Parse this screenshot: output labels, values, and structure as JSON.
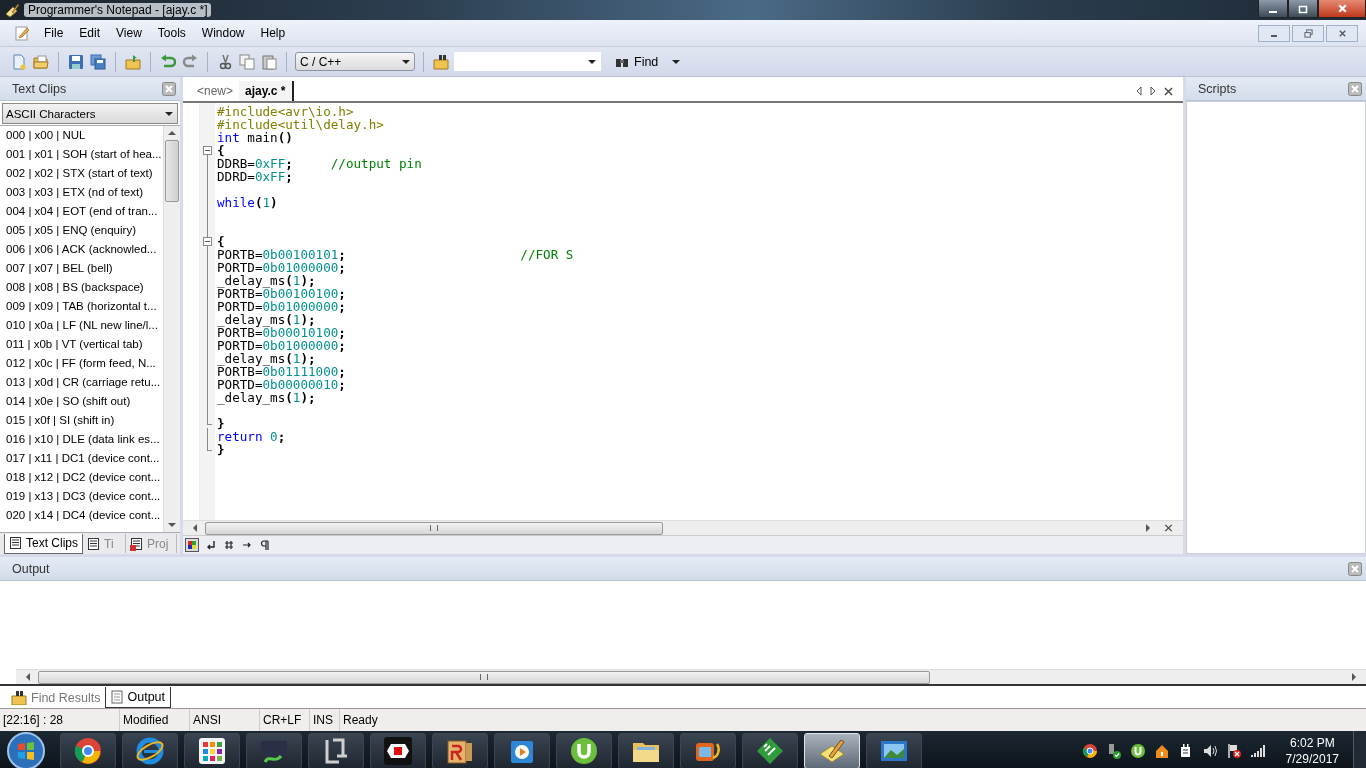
{
  "window": {
    "title": "Programmer's Notepad - [ajay.c *]"
  },
  "menu": [
    "File",
    "Edit",
    "View",
    "Tools",
    "Window",
    "Help"
  ],
  "toolbar": {
    "scheme": "C / C++",
    "find_label": "Find"
  },
  "text_clips": {
    "title": "Text Clips",
    "category": "ASCII Characters",
    "items": [
      "000 | x00 | NUL",
      "001 | x01 | SOH (start of hea...",
      "002 | x02 | STX (start of text)",
      "003 | x03 | ETX (nd of text)",
      "004 | x04 | EOT (end of tran...",
      "005 | x05 | ENQ (enquiry)",
      "006 | x06 | ACK (acknowled...",
      "007 | x07 | BEL (bell)",
      "008 | x08 | BS (backspace)",
      "009 | x09 | TAB (horizontal t...",
      "010 | x0a | LF (NL new line/l...",
      "011 | x0b | VT (vertical tab)",
      "012 | x0c | FF (form feed, N...",
      "013 | x0d | CR (carriage retu...",
      "014 | x0e | SO (shift out)",
      "015 | x0f | SI (shift in)",
      "016 | x10 | DLE (data link es...",
      "017 | x11 | DC1 (device cont...",
      "018 | x12 | DC2 (device cont...",
      "019 | x13 | DC3 (device cont...",
      "020 | x14 | DC4 (device cont..."
    ],
    "tabs": [
      {
        "label": "Text Clips",
        "selected": true
      },
      {
        "label": "Ti",
        "selected": false
      },
      {
        "label": "Proj",
        "selected": false
      }
    ]
  },
  "editor": {
    "tabs": [
      {
        "label": "<new>",
        "selected": false
      },
      {
        "label": "ajay.c *",
        "selected": true
      }
    ],
    "lines": [
      {
        "kind": "code",
        "tokens": [
          {
            "kind": "pre",
            "text": "#include<avr\\io.h>"
          }
        ]
      },
      {
        "kind": "code",
        "tokens": [
          {
            "kind": "pre",
            "text": "#include<util\\delay.h>"
          }
        ]
      },
      {
        "kind": "code",
        "tokens": [
          {
            "kind": "kw",
            "text": "int"
          },
          {
            "kind": "txt",
            "text": " main"
          },
          {
            "kind": "op",
            "text": "()"
          }
        ]
      },
      {
        "kind": "block",
        "children": [
          {
            "kind": "code",
            "tokens": [
              {
                "kind": "op",
                "text": "{"
              }
            ]
          },
          {
            "kind": "code",
            "tokens": [
              {
                "kind": "txt",
                "text": "DDRB="
              },
              {
                "kind": "num",
                "text": "0xFF"
              },
              {
                "kind": "op",
                "text": ";"
              },
              {
                "kind": "com",
                "text": "     //output pin"
              }
            ]
          },
          {
            "kind": "code",
            "tokens": [
              {
                "kind": "txt",
                "text": "DDRD="
              },
              {
                "kind": "num",
                "text": "0xFF"
              },
              {
                "kind": "op",
                "text": ";"
              }
            ]
          },
          {
            "kind": "blank"
          },
          {
            "kind": "code",
            "tokens": [
              {
                "kind": "kw",
                "text": "while"
              },
              {
                "kind": "op",
                "text": "("
              },
              {
                "kind": "num",
                "text": "1"
              },
              {
                "kind": "op",
                "text": ")"
              }
            ]
          },
          {
            "kind": "blank"
          },
          {
            "kind": "blank"
          },
          {
            "kind": "block",
            "children": [
              {
                "kind": "code",
                "tokens": [
                  {
                    "kind": "op",
                    "text": "{"
                  }
                ]
              },
              {
                "kind": "code",
                "tokens": [
                  {
                    "kind": "txt",
                    "text": "PORTB="
                  },
                  {
                    "kind": "num",
                    "text": "0b00100101"
                  },
                  {
                    "kind": "op",
                    "text": ";"
                  },
                  {
                    "kind": "com",
                    "text": "                       //FOR S"
                  }
                ]
              },
              {
                "kind": "code",
                "tokens": [
                  {
                    "kind": "txt",
                    "text": "PORTD="
                  },
                  {
                    "kind": "num",
                    "text": "0b01000000"
                  },
                  {
                    "kind": "op",
                    "text": ";"
                  }
                ]
              },
              {
                "kind": "code",
                "tokens": [
                  {
                    "kind": "txt",
                    "text": "_delay_ms"
                  },
                  {
                    "kind": "op",
                    "text": "("
                  },
                  {
                    "kind": "num",
                    "text": "1"
                  },
                  {
                    "kind": "op",
                    "text": ");"
                  }
                ]
              },
              {
                "kind": "code",
                "tokens": [
                  {
                    "kind": "txt",
                    "text": "PORTB="
                  },
                  {
                    "kind": "num",
                    "text": "0b00100100"
                  },
                  {
                    "kind": "op",
                    "text": ";"
                  }
                ]
              },
              {
                "kind": "code",
                "tokens": [
                  {
                    "kind": "txt",
                    "text": "PORTD="
                  },
                  {
                    "kind": "num",
                    "text": "0b01000000"
                  },
                  {
                    "kind": "op",
                    "text": ";"
                  }
                ]
              },
              {
                "kind": "code",
                "tokens": [
                  {
                    "kind": "txt",
                    "text": "_delay_ms"
                  },
                  {
                    "kind": "op",
                    "text": "("
                  },
                  {
                    "kind": "num",
                    "text": "1"
                  },
                  {
                    "kind": "op",
                    "text": ");"
                  }
                ]
              },
              {
                "kind": "code",
                "tokens": [
                  {
                    "kind": "txt",
                    "text": "PORTB="
                  },
                  {
                    "kind": "num",
                    "text": "0b00010100"
                  },
                  {
                    "kind": "op",
                    "text": ";"
                  }
                ]
              },
              {
                "kind": "code",
                "tokens": [
                  {
                    "kind": "txt",
                    "text": "PORTD="
                  },
                  {
                    "kind": "num",
                    "text": "0b01000000"
                  },
                  {
                    "kind": "op",
                    "text": ";"
                  }
                ]
              },
              {
                "kind": "code",
                "tokens": [
                  {
                    "kind": "txt",
                    "text": "_delay_ms"
                  },
                  {
                    "kind": "op",
                    "text": "("
                  },
                  {
                    "kind": "num",
                    "text": "1"
                  },
                  {
                    "kind": "op",
                    "text": ");"
                  }
                ]
              },
              {
                "kind": "code",
                "tokens": [
                  {
                    "kind": "txt",
                    "text": "PORTB="
                  },
                  {
                    "kind": "num",
                    "text": "0b01111000"
                  },
                  {
                    "kind": "op",
                    "text": ";"
                  }
                ]
              },
              {
                "kind": "code",
                "tokens": [
                  {
                    "kind": "txt",
                    "text": "PORTD="
                  },
                  {
                    "kind": "num",
                    "text": "0b00000010"
                  },
                  {
                    "kind": "op",
                    "text": ";"
                  }
                ]
              },
              {
                "kind": "code",
                "tokens": [
                  {
                    "kind": "txt",
                    "text": "_delay_ms"
                  },
                  {
                    "kind": "op",
                    "text": "("
                  },
                  {
                    "kind": "num",
                    "text": "1"
                  },
                  {
                    "kind": "op",
                    "text": ");"
                  }
                ]
              },
              {
                "kind": "blank"
              },
              {
                "kind": "code",
                "tokens": [
                  {
                    "kind": "op",
                    "text": "}"
                  }
                ]
              }
            ]
          },
          {
            "kind": "code",
            "tokens": [
              {
                "kind": "kw",
                "text": "return"
              },
              {
                "kind": "num",
                "text": " 0"
              },
              {
                "kind": "op",
                "text": ";"
              }
            ]
          },
          {
            "kind": "code",
            "tokens": [
              {
                "kind": "op",
                "text": "}"
              }
            ]
          }
        ]
      }
    ]
  },
  "scripts": {
    "title": "Scripts"
  },
  "output": {
    "title": "Output",
    "tabs": [
      {
        "label": "Find Results",
        "selected": false
      },
      {
        "label": "Output",
        "selected": true
      }
    ]
  },
  "status_bar": [
    "[22:16] : 28",
    "Modified",
    "ANSI",
    "CR+LF",
    "INS",
    "Ready"
  ],
  "taskbar": {
    "apps": [
      {
        "kind": "chrome",
        "selected": false
      },
      {
        "kind": "ie",
        "selected": false
      },
      {
        "kind": "apps",
        "selected": false
      },
      {
        "kind": "snake",
        "selected": false
      },
      {
        "kind": "bracket",
        "selected": false
      },
      {
        "kind": "record",
        "selected": false
      },
      {
        "kind": "blocks",
        "selected": false
      },
      {
        "kind": "player",
        "selected": false
      },
      {
        "kind": "torrent",
        "selected": false
      },
      {
        "kind": "folder",
        "selected": false
      },
      {
        "kind": "film",
        "selected": false
      },
      {
        "kind": "circuit",
        "selected": false
      },
      {
        "kind": "notepad",
        "selected": true
      },
      {
        "kind": "photo",
        "selected": false
      }
    ],
    "time": "6:02 PM",
    "date": "7/29/2017"
  }
}
